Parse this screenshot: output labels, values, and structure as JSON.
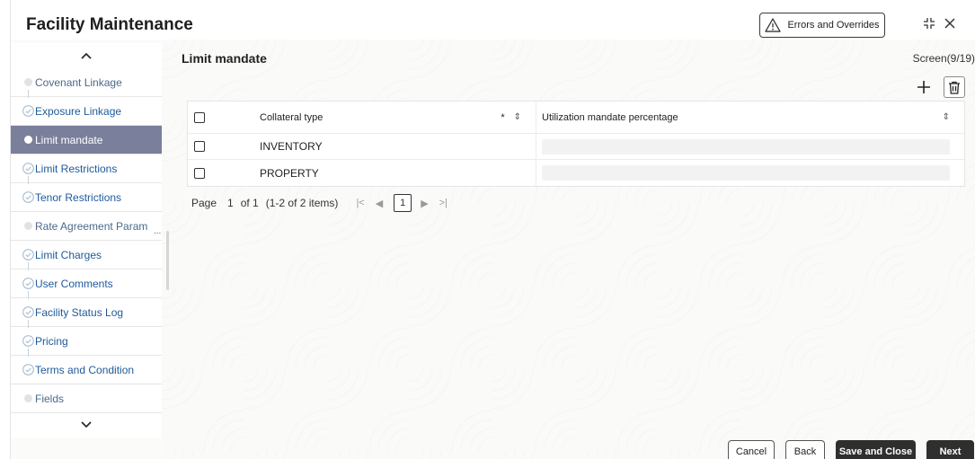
{
  "header": {
    "title": "Facility Maintenance",
    "errors_button": "Errors and Overrides"
  },
  "sidebar": {
    "items": [
      {
        "label": "Covenant Linkage",
        "state": "pending"
      },
      {
        "label": "Exposure Linkage",
        "state": "done"
      },
      {
        "label": "Limit mandate",
        "state": "active"
      },
      {
        "label": "Limit Restrictions",
        "state": "done"
      },
      {
        "label": "Tenor Restrictions",
        "state": "done"
      },
      {
        "label": "Rate Agreement Param",
        "state": "pending"
      },
      {
        "label": "Limit Charges",
        "state": "done"
      },
      {
        "label": "User Comments",
        "state": "done"
      },
      {
        "label": "Facility Status Log",
        "state": "done"
      },
      {
        "label": "Pricing",
        "state": "done"
      },
      {
        "label": "Terms and Condition",
        "state": "done"
      },
      {
        "label": "Fields",
        "state": "pending"
      }
    ],
    "overflow_marker": "..."
  },
  "main": {
    "section_title": "Limit mandate",
    "screen_indicator": "Screen(9/19)",
    "grid": {
      "columns": {
        "collateral_type": "Collateral type",
        "required_marker": "*",
        "utilization": "Utilization mandate percentage"
      },
      "rows": [
        {
          "collateral_type": "INVENTORY",
          "utilization": ""
        },
        {
          "collateral_type": "PROPERTY",
          "utilization": ""
        }
      ]
    },
    "pagination": {
      "page_label": "Page",
      "current_page": "1",
      "of_label": "of 1",
      "items_label": "(1-2 of 2 items)",
      "page_box": "1"
    }
  },
  "footer": {
    "cancel": "Cancel",
    "back": "Back",
    "save_and_close": "Save and Close",
    "next": "Next"
  }
}
